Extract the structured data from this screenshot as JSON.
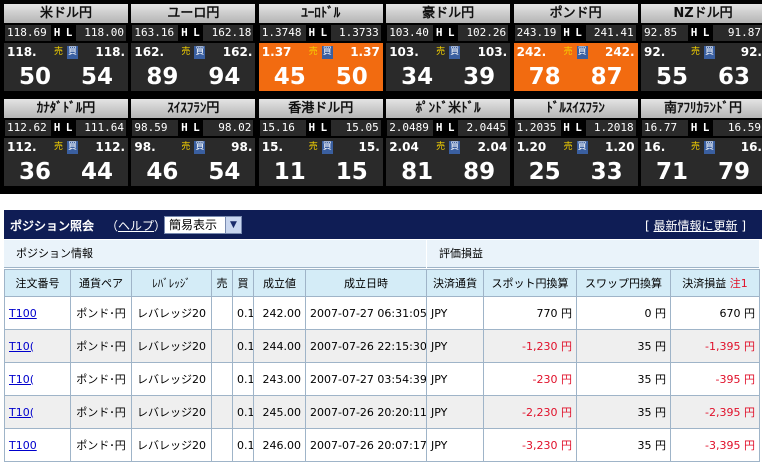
{
  "tiles": [
    {
      "name": "米ドル円",
      "high": "118.69",
      "low": "118.00",
      "bid_pre": "118.",
      "ask_pre": "118.",
      "bid": "50",
      "ask": "54",
      "hot": false
    },
    {
      "name": "ユーロ円",
      "high": "163.16",
      "low": "162.18",
      "bid_pre": "162.",
      "ask_pre": "162.",
      "bid": "89",
      "ask": "94",
      "hot": false
    },
    {
      "name": "ﾕｰﾛﾄﾞﾙ",
      "high": "1.3748",
      "low": "1.3733",
      "bid_pre": "1.37",
      "ask_pre": "1.37",
      "bid": "45",
      "ask": "50",
      "hot": true
    },
    {
      "name": "豪ドル円",
      "high": "103.40",
      "low": "102.26",
      "bid_pre": "103.",
      "ask_pre": "103.",
      "bid": "34",
      "ask": "39",
      "hot": false
    },
    {
      "name": "ポンド円",
      "high": "243.19",
      "low": "241.41",
      "bid_pre": "242.",
      "ask_pre": "242.",
      "bid": "78",
      "ask": "87",
      "hot": true
    },
    {
      "name": "NZドル円",
      "high": "92.85",
      "low": "91.87",
      "bid_pre": "92.",
      "ask_pre": "92.",
      "bid": "55",
      "ask": "63",
      "hot": false
    },
    {
      "name": "ｶﾅﾀﾞﾄﾞﾙ円",
      "high": "112.62",
      "low": "111.64",
      "bid_pre": "112.",
      "ask_pre": "112.",
      "bid": "36",
      "ask": "44",
      "hot": false
    },
    {
      "name": "ｽｲｽﾌﾗﾝ円",
      "high": "98.59",
      "low": "98.02",
      "bid_pre": "98.",
      "ask_pre": "98.",
      "bid": "46",
      "ask": "54",
      "hot": false
    },
    {
      "name": "香港ドル円",
      "high": "15.16",
      "low": "15.05",
      "bid_pre": "15.",
      "ask_pre": "15.",
      "bid": "11",
      "ask": "15",
      "hot": false
    },
    {
      "name": "ﾎﾟﾝﾄﾞ米ﾄﾞﾙ",
      "high": "2.0489",
      "low": "2.0445",
      "bid_pre": "2.04",
      "ask_pre": "2.04",
      "bid": "81",
      "ask": "89",
      "hot": false
    },
    {
      "name": "ﾄﾞﾙｽｲｽﾌﾗﾝ",
      "high": "1.2035",
      "low": "1.2018",
      "bid_pre": "1.20",
      "ask_pre": "1.20",
      "bid": "25",
      "ask": "33",
      "hot": false
    },
    {
      "name": "南ｱﾌﾘｶﾗﾝﾄﾞ円",
      "high": "16.77",
      "low": "16.59",
      "bid_pre": "16.",
      "ask_pre": "16.",
      "bid": "71",
      "ask": "79",
      "hot": false
    }
  ],
  "tile_labels": {
    "h": "H",
    "l": "L",
    "sell": "売",
    "buy": "買"
  },
  "panel": {
    "title": "ポジション照会",
    "help_open": "（",
    "help": "ヘルプ",
    "help_close": "）",
    "view_select": "簡易表示",
    "view_arrow": "▼",
    "update_open": "[ ",
    "update": "最新情報に更新",
    "update_close": " ]",
    "section_position": "ポジション情報",
    "section_pnl": "評価損益"
  },
  "columns": [
    "注文番号",
    "通貨ペア",
    "ﾚﾊﾞﾚｯｼﾞ",
    "売",
    "買",
    "成立値",
    "成立日時",
    "決済通貨",
    "スポット円換算",
    "スワップ円換算",
    "決済損益"
  ],
  "note_label": "注1",
  "rows": [
    {
      "order": "T100",
      "pair": "ポンド･円",
      "lev": "レバレッジ20",
      "sell": "",
      "buy": "0.1",
      "price": "242.00",
      "datetime": "2007-07-27 06:31:05",
      "ccy": "JPY",
      "spot": "770 円",
      "swap": "0 円",
      "pnl": "670 円",
      "spot_neg": false,
      "pnl_neg": false
    },
    {
      "order": "T10(",
      "pair": "ポンド･円",
      "lev": "レバレッジ20",
      "sell": "",
      "buy": "0.1",
      "price": "244.00",
      "datetime": "2007-07-26 22:15:30",
      "ccy": "JPY",
      "spot": "-1,230 円",
      "swap": "35 円",
      "pnl": "-1,395 円",
      "spot_neg": true,
      "pnl_neg": true
    },
    {
      "order": "T10(",
      "pair": "ポンド･円",
      "lev": "レバレッジ20",
      "sell": "",
      "buy": "0.1",
      "price": "243.00",
      "datetime": "2007-07-27 03:54:39",
      "ccy": "JPY",
      "spot": "-230 円",
      "swap": "35 円",
      "pnl": "-395 円",
      "spot_neg": true,
      "pnl_neg": true
    },
    {
      "order": "T10(",
      "pair": "ポンド･円",
      "lev": "レバレッジ20",
      "sell": "",
      "buy": "0.1",
      "price": "245.00",
      "datetime": "2007-07-26 20:20:11",
      "ccy": "JPY",
      "spot": "-2,230 円",
      "swap": "35 円",
      "pnl": "-2,395 円",
      "spot_neg": true,
      "pnl_neg": true
    },
    {
      "order": "T100",
      "pair": "ポンド･円",
      "lev": "レバレッジ20",
      "sell": "",
      "buy": "0.1",
      "price": "246.00",
      "datetime": "2007-07-26 20:07:17",
      "ccy": "JPY",
      "spot": "-3,230 円",
      "swap": "35 円",
      "pnl": "-3,395 円",
      "spot_neg": true,
      "pnl_neg": true
    }
  ],
  "colors": {
    "board_bg": "#000000",
    "tile_dark": "#2a2a2a",
    "tile_hot": "#f26b10",
    "header_navy": "#0f1d55",
    "negative": "#e0102a",
    "link": "#0000cc"
  }
}
